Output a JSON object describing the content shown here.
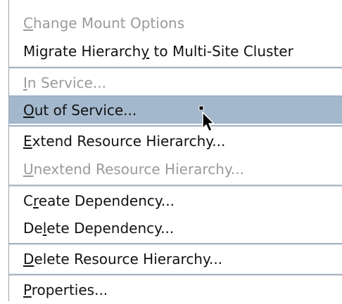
{
  "menu": {
    "items": [
      {
        "pre": "",
        "mn": "C",
        "post": "hange Mount Options",
        "disabled": true
      },
      {
        "pre": "Migrate Hierarch",
        "mn": "y",
        "post": " to Multi-Site Cluster",
        "disabled": false
      },
      {
        "pre": "",
        "mn": "I",
        "post": "n Service...",
        "disabled": true
      },
      {
        "pre": "",
        "mn": "O",
        "post": "ut of Service...",
        "disabled": false,
        "selected": true
      },
      {
        "pre": "",
        "mn": "E",
        "post": "xtend Resource Hierarchy...",
        "disabled": false
      },
      {
        "pre": "",
        "mn": "U",
        "post": "nextend Resource Hierarchy...",
        "disabled": true
      },
      {
        "pre": "C",
        "mn": "r",
        "post": "eate Dependency...",
        "disabled": false
      },
      {
        "pre": "De",
        "mn": "l",
        "post": "ete Dependency...",
        "disabled": false
      },
      {
        "pre": "",
        "mn": "D",
        "post": "elete Resource Hierarchy...",
        "disabled": false
      },
      {
        "pre": "",
        "mn": "P",
        "post": "roperties...",
        "disabled": false
      }
    ]
  },
  "cursor": {
    "icon": "mouse-pointer-icon"
  },
  "colors": {
    "selection": "#a3b8cc",
    "text": "#111111",
    "disabled_text": "#9a9a9a",
    "separator": "#a9b6c4"
  }
}
